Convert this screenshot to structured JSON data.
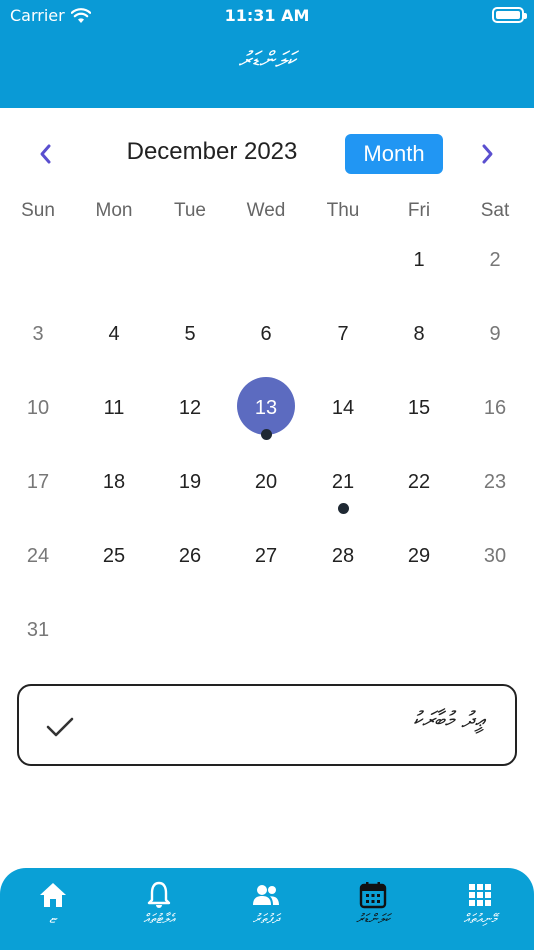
{
  "status": {
    "carrier": "Carrier",
    "time": "11:31 AM",
    "battery_level": 1.0
  },
  "header": {
    "title": "ކަލަންޑަރު"
  },
  "calendar": {
    "month_label": "December 2023",
    "view_button": "Month",
    "weekdays": [
      "Sun",
      "Mon",
      "Tue",
      "Wed",
      "Thu",
      "Fri",
      "Sat"
    ],
    "weeks": [
      [
        "",
        "",
        "",
        "",
        "",
        "1",
        "2"
      ],
      [
        "3",
        "4",
        "5",
        "6",
        "7",
        "8",
        "9"
      ],
      [
        "10",
        "11",
        "12",
        "13",
        "14",
        "15",
        "16"
      ],
      [
        "17",
        "18",
        "19",
        "20",
        "21",
        "22",
        "23"
      ],
      [
        "24",
        "25",
        "26",
        "27",
        "28",
        "29",
        "30"
      ],
      [
        "31",
        "",
        "",
        "",
        "",
        "",
        ""
      ]
    ],
    "selected_day": "13",
    "days_with_events": [
      "13",
      "21"
    ]
  },
  "event": {
    "text": "ޢީދު މުބާރަކު",
    "completed": true
  },
  "tabbar": {
    "items": [
      {
        "label": "ޏ",
        "icon": "home-icon"
      },
      {
        "label": "އެލާޓުތައް",
        "icon": "bell-icon"
      },
      {
        "label": "ދަފުތަރު",
        "icon": "people-icon"
      },
      {
        "label": "ކަލަންޑަރު",
        "icon": "calendar-icon",
        "active": true
      },
      {
        "label": "މޭނިއުތައް",
        "icon": "grid-icon"
      }
    ]
  },
  "colors": {
    "header": "#0a9ad6",
    "accent": "#2196f3",
    "selected": "#5c6bc0",
    "nav_arrow": "#5a4fcf"
  }
}
